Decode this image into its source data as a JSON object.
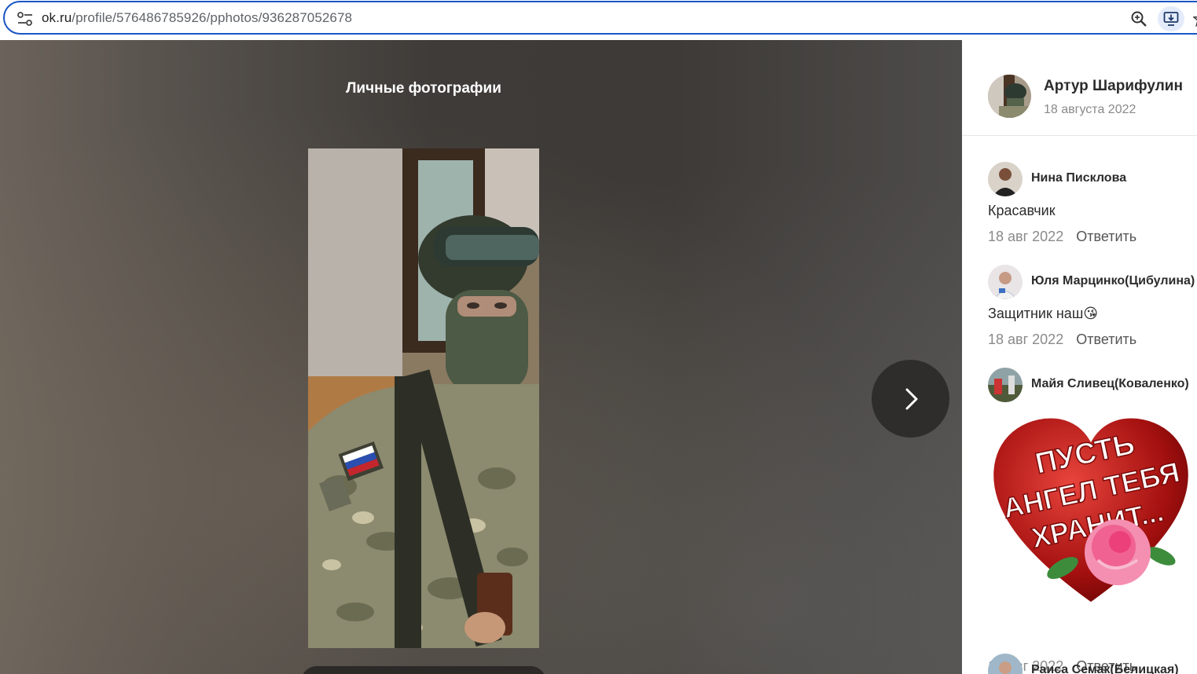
{
  "browser": {
    "url_host": "ok.ru",
    "url_path": "/profile/576486785926/pphotos/936287052678"
  },
  "viewer": {
    "album_title": "Личные фотографии"
  },
  "author": {
    "name": "Артур Шарифулин",
    "date": "18 августа 2022"
  },
  "comments": [
    {
      "name": "Нина Писклова",
      "text": "Красавчик",
      "date": "18 авг 2022",
      "reply": "Ответить"
    },
    {
      "name": "Юля Марцинко(Цибулина)",
      "text": "Защитник наш",
      "emoji": "😘",
      "date": "18 авг 2022",
      "reply": "Ответить"
    },
    {
      "name": "Майя Сливец(Коваленко)",
      "sticker_lines": [
        "ПУСТЬ",
        "АНГЕЛ ТЕБЯ",
        "ХРАНИТ..."
      ],
      "date": "18 авг 2022",
      "reply": "Ответить"
    },
    {
      "name": "Раиса Семак(Белицкая)"
    }
  ]
}
